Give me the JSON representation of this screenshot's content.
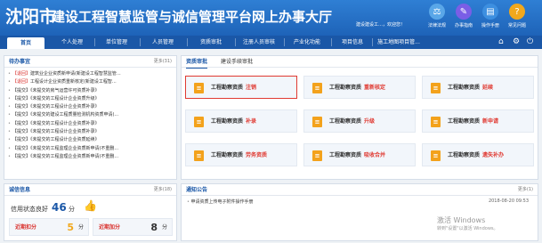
{
  "header": {
    "city": "沈阳市",
    "title": "建设工程智慧监管与诚信管理平台网上办事大厅",
    "user_text": "建设建设工…，欢迎您！",
    "tools": [
      {
        "label": "法律法规",
        "icon": "scale-icon",
        "color": "#5aa7e8"
      },
      {
        "label": "办事指南",
        "icon": "compass-icon",
        "color": "#7a5ee6"
      },
      {
        "label": "操作手册",
        "icon": "book-icon",
        "color": "#3d8fe0"
      },
      {
        "label": "常见问题",
        "icon": "question-icon",
        "color": "#f1a81d"
      }
    ]
  },
  "nav": {
    "items": [
      "首页",
      "个人处理",
      "单位管理",
      "人员管理",
      "资质审批",
      "注册人员审核",
      "产业化功能",
      "项目信息",
      "施工地图项目管..."
    ],
    "icons": [
      "home-icon",
      "gear-icon",
      "power-icon"
    ]
  },
  "todo": {
    "title": "待办事宜",
    "more": "更多(31)",
    "items": [
      {
        "tag": "【退回】",
        "red": true,
        "text": "建筑业企业资质新申请(新建设工程智慧监管..."
      },
      {
        "tag": "【退回】",
        "red": true,
        "text": "工程设计企业资质重新核定(新建设工程智..."
      },
      {
        "tag": "【提交】",
        "red": false,
        "text": "《未提交的房气运营许可资质补录》"
      },
      {
        "tag": "【提交】",
        "red": false,
        "text": "《未提交的工程设计企业资质升级》"
      },
      {
        "tag": "【提交】",
        "red": false,
        "text": "《未提交的工程设计企业资质补录》"
      },
      {
        "tag": "【提交】",
        "red": false,
        "text": "《未提交的建设工程质量检测机构资质申请(..."
      },
      {
        "tag": "【提交】",
        "red": false,
        "text": "《未提交的工程设计企业资质补录》"
      },
      {
        "tag": "【提交】",
        "red": false,
        "text": "《未提交的工程设计企业资质补录》"
      },
      {
        "tag": "【提交】",
        "red": false,
        "text": "《未提交的工程设计企业资质延续》"
      },
      {
        "tag": "【提交】",
        "red": false,
        "text": "《未提交的工程监理企业资质新申请(不重删..."
      },
      {
        "tag": "【提交】",
        "red": false,
        "text": "《未提交的工程监理企业资质新申请(不重删..."
      }
    ]
  },
  "services": {
    "tabs": [
      "资质审批",
      "建设手续审批"
    ],
    "tiles": [
      {
        "name": "工程勘察资质",
        "action": "注销",
        "selected": true
      },
      {
        "name": "工程勘察资质",
        "action": "重新核定",
        "selected": false
      },
      {
        "name": "工程勘察资质",
        "action": "延续",
        "selected": false
      },
      {
        "name": "工程勘察资质",
        "action": "补录",
        "selected": false
      },
      {
        "name": "工程勘察资质",
        "action": "升级",
        "selected": false
      },
      {
        "name": "工程勘察资质",
        "action": "新申请",
        "selected": false
      },
      {
        "name": "工程勘察资质",
        "action": "劳务资质",
        "selected": false
      },
      {
        "name": "工程勘察资质",
        "action": "吸收合并",
        "selected": false
      },
      {
        "name": "工程勘察资质",
        "action": "遗失补办",
        "selected": false
      }
    ]
  },
  "credit": {
    "title": "诚信信息",
    "more": "更多(18)",
    "status_label": "信用状态良好",
    "status_value": "46",
    "status_unit": "分",
    "deduct_label": "近期扣分",
    "deduct_value": "5",
    "deduct_unit": "分",
    "bonus_label": "近期加分",
    "bonus_value": "8",
    "bonus_unit": "分"
  },
  "notice": {
    "title": "通知公告",
    "more": "更多(1)",
    "items": [
      {
        "text": "申请资质上传电子附件操作手册",
        "date": "2018-08-20 09:53"
      }
    ]
  },
  "watermark": {
    "line1": "激活 Windows",
    "line2": "转到\"设置\"以激活 Windows。"
  }
}
